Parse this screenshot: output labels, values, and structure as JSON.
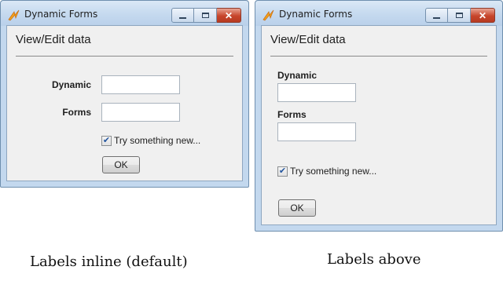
{
  "windows": [
    {
      "title": "Dynamic Forms",
      "form_title": "View/Edit data",
      "fields": [
        {
          "label": "Dynamic",
          "value": ""
        },
        {
          "label": "Forms",
          "value": ""
        }
      ],
      "checkbox": {
        "label": "Try something new...",
        "checked": true
      },
      "ok_label": "OK"
    },
    {
      "title": "Dynamic Forms",
      "form_title": "View/Edit data",
      "fields": [
        {
          "label": "Dynamic",
          "value": ""
        },
        {
          "label": "Forms",
          "value": ""
        }
      ],
      "checkbox": {
        "label": "Try something new...",
        "checked": true
      },
      "ok_label": "OK"
    }
  ],
  "captions": {
    "left": "Labels inline (default)",
    "right": "Labels above"
  },
  "icons": {
    "app": "app-icon",
    "minimize": "minimize-icon",
    "maximize": "maximize-icon",
    "close": "close-icon",
    "check": "checkmark-icon"
  },
  "colors": {
    "window_frame": "#c3d8ee",
    "client_bg": "#f0f0f0",
    "close_button": "#c7452b"
  }
}
